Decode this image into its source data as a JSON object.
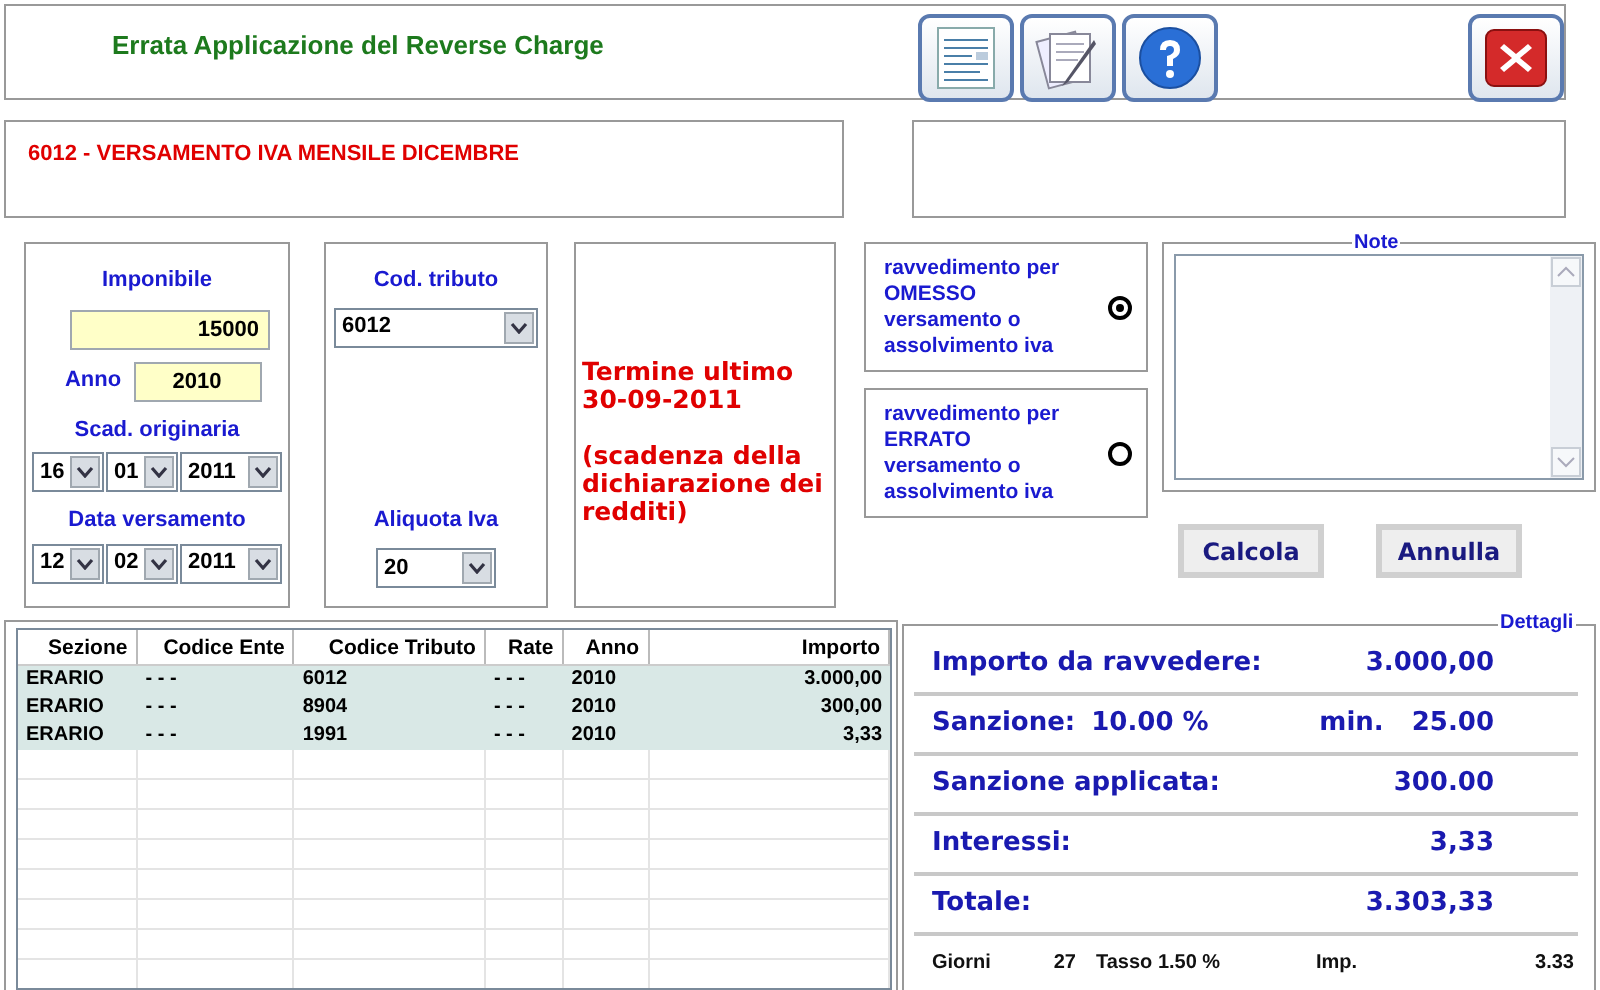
{
  "window": {
    "title": "Errata Applicazione del Reverse Charge"
  },
  "description": "6012 - VERSAMENTO IVA MENSILE DICEMBRE",
  "imponibile": {
    "label": "Imponibile",
    "value": "15000"
  },
  "anno": {
    "label": "Anno",
    "value": "2010"
  },
  "scad_originaria": {
    "label": "Scad. originaria",
    "day": "16",
    "month": "01",
    "year": "2011"
  },
  "data_versamento": {
    "label": "Data versamento",
    "day": "12",
    "month": "02",
    "year": "2011"
  },
  "cod_tributo": {
    "label": "Cod. tributo",
    "value": "6012"
  },
  "aliquota_iva": {
    "label": "Aliquota Iva",
    "value": "20"
  },
  "deadline": {
    "text": "Termine ultimo\n30-09-2011",
    "note": "(scadenza della\ndichiarazione dei\nredditi)"
  },
  "ravvedimento": [
    {
      "label": "ravvedimento per\nOMESSO\nversamento o\nassolvimento iva",
      "selected": true
    },
    {
      "label": "ravvedimento per\nERRATO\nversamento o\nassolvimento iva",
      "selected": false
    }
  ],
  "note": {
    "label": "Note"
  },
  "buttons": [
    "Calcola",
    "Annulla"
  ],
  "table": {
    "columns": [
      "Sezione",
      "Codice Ente",
      "Codice Tributo",
      "Rate",
      "Anno",
      "Importo"
    ],
    "rows": [
      [
        "ERARIO",
        "- - -",
        "6012",
        "- - -",
        "2010",
        "3.000,00"
      ],
      [
        "ERARIO",
        "- - -",
        "8904",
        "- - -",
        "2010",
        "300,00"
      ],
      [
        "ERARIO",
        "- - -",
        "1991",
        "- - -",
        "2010",
        "3,33"
      ]
    ]
  },
  "dettagli": {
    "title": "Dettagli",
    "rows": [
      {
        "label": "Importo da ravvedere:",
        "value": "3.000,00"
      },
      {
        "label": "Sanzione:",
        "rate": "10.00 %",
        "min_label": "min.",
        "value": "25.00"
      },
      {
        "label": "Sanzione applicata:",
        "value": "300.00"
      },
      {
        "label": "Interessi:",
        "value": "3,33"
      },
      {
        "label": "Totale:",
        "value": "3.303,33"
      }
    ],
    "footer": {
      "giorni_label": "Giorni",
      "giorni": "27",
      "tasso": "Tasso 1.50 %",
      "imp_label": "Imp.",
      "imp": "3.33"
    }
  }
}
